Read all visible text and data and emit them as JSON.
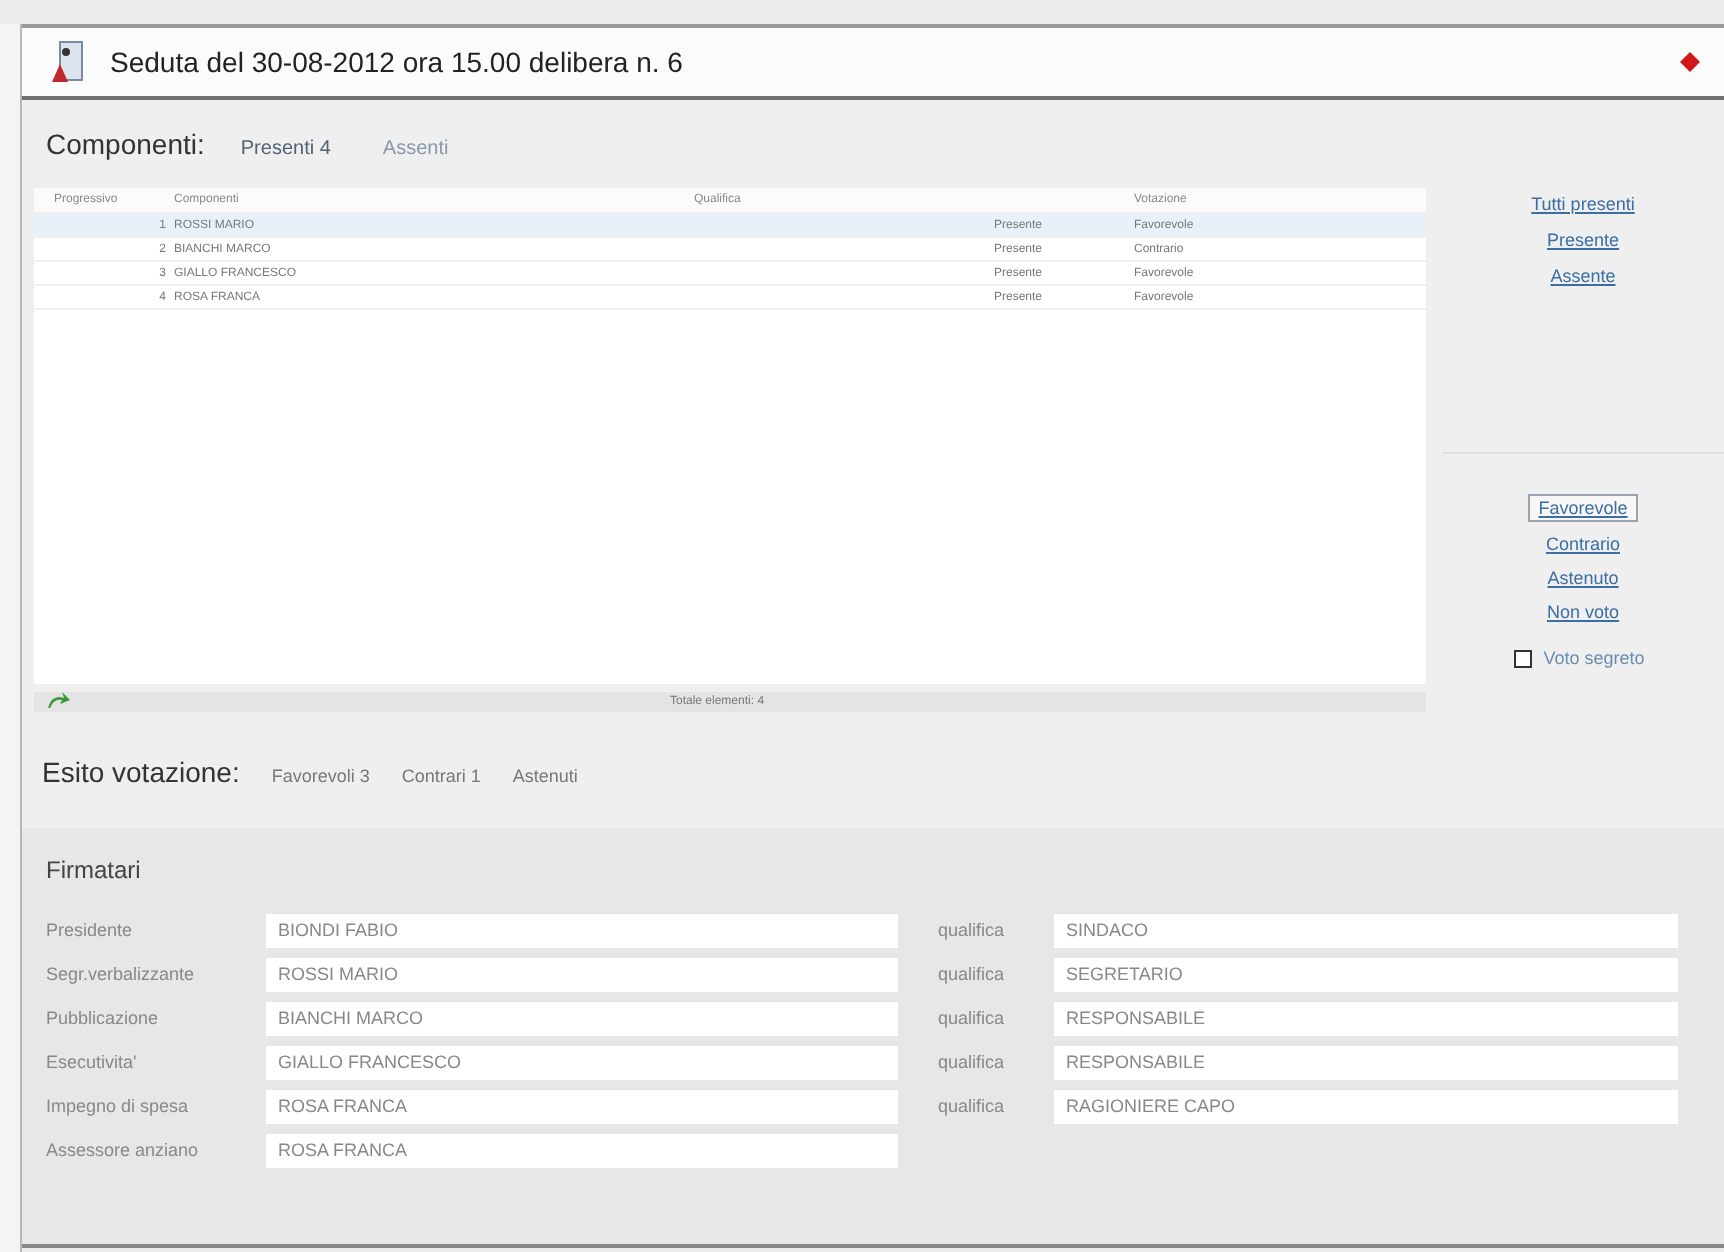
{
  "window": {
    "title": "Seduta del 30-08-2012 ora 15.00 delibera n. 6"
  },
  "componenti": {
    "label": "Componenti:",
    "tabs": [
      {
        "label": "Presenti 4",
        "selected": true
      },
      {
        "label": "Assenti",
        "selected": false
      }
    ]
  },
  "table": {
    "columns": [
      "Progressivo",
      "Componenti",
      "Qualifica",
      "Votazione"
    ],
    "rows": [
      {
        "number": "1",
        "name": "ROSSI MARIO",
        "qualifica": "",
        "presence": "Presente",
        "vote": "Favorevole",
        "selected": true
      },
      {
        "number": "2",
        "name": "BIANCHI MARCO",
        "qualifica": "",
        "presence": "Presente",
        "vote": "Contrario",
        "selected": false
      },
      {
        "number": "3",
        "name": "GIALLO FRANCESCO",
        "qualifica": "",
        "presence": "Presente",
        "vote": "Favorevole",
        "selected": false
      },
      {
        "number": "4",
        "name": "ROSA FRANCA",
        "qualifica": "",
        "presence": "Presente",
        "vote": "Favorevole",
        "selected": false
      }
    ],
    "footer": "Totale elementi: 4"
  },
  "presence_actions": [
    "Tutti presenti",
    "Presente",
    "Assente"
  ],
  "vote_actions": [
    {
      "label": "Favorevole",
      "selected": true
    },
    {
      "label": "Contrario",
      "selected": false
    },
    {
      "label": "Astenuto",
      "selected": false
    },
    {
      "label": "Non voto",
      "selected": false
    }
  ],
  "secret_vote": {
    "label": "Voto segreto",
    "checked": false
  },
  "esito": {
    "label": "Esito votazione:",
    "items": [
      "Favorevoli 3",
      "Contrari 1",
      "Astenuti"
    ]
  },
  "firmatari": {
    "title": "Firmatari",
    "rows": [
      {
        "label": "Presidente",
        "value": "BIONDI FABIO",
        "qualifica_label": "qualifica",
        "qualifica": "SINDACO"
      },
      {
        "label": "Segr.verbalizzante",
        "value": "ROSSI MARIO",
        "qualifica_label": "qualifica",
        "qualifica": "SEGRETARIO"
      },
      {
        "label": "Pubblicazione",
        "value": "BIANCHI MARCO",
        "qualifica_label": "qualifica",
        "qualifica": "RESPONSABILE"
      },
      {
        "label": "Esecutivita'",
        "value": "GIALLO FRANCESCO",
        "qualifica_label": "qualifica",
        "qualifica": "RESPONSABILE"
      },
      {
        "label": "Impegno di spesa",
        "value": "ROSA FRANCA",
        "qualifica_label": "qualifica",
        "qualifica": "RAGIONIERE CAPO"
      },
      {
        "label": "Assessore anziano",
        "value": "ROSA FRANCA"
      }
    ]
  }
}
